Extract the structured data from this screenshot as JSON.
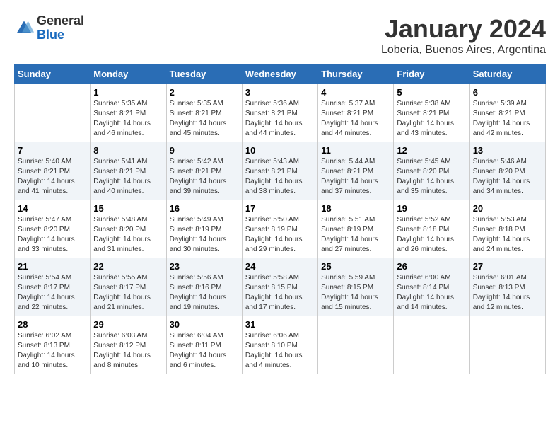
{
  "logo": {
    "general": "General",
    "blue": "Blue"
  },
  "header": {
    "title": "January 2024",
    "subtitle": "Loberia, Buenos Aires, Argentina"
  },
  "weekdays": [
    "Sunday",
    "Monday",
    "Tuesday",
    "Wednesday",
    "Thursday",
    "Friday",
    "Saturday"
  ],
  "weeks": [
    [
      {
        "day": "",
        "info": ""
      },
      {
        "day": "1",
        "info": "Sunrise: 5:35 AM\nSunset: 8:21 PM\nDaylight: 14 hours\nand 46 minutes."
      },
      {
        "day": "2",
        "info": "Sunrise: 5:35 AM\nSunset: 8:21 PM\nDaylight: 14 hours\nand 45 minutes."
      },
      {
        "day": "3",
        "info": "Sunrise: 5:36 AM\nSunset: 8:21 PM\nDaylight: 14 hours\nand 44 minutes."
      },
      {
        "day": "4",
        "info": "Sunrise: 5:37 AM\nSunset: 8:21 PM\nDaylight: 14 hours\nand 44 minutes."
      },
      {
        "day": "5",
        "info": "Sunrise: 5:38 AM\nSunset: 8:21 PM\nDaylight: 14 hours\nand 43 minutes."
      },
      {
        "day": "6",
        "info": "Sunrise: 5:39 AM\nSunset: 8:21 PM\nDaylight: 14 hours\nand 42 minutes."
      }
    ],
    [
      {
        "day": "7",
        "info": "Sunrise: 5:40 AM\nSunset: 8:21 PM\nDaylight: 14 hours\nand 41 minutes."
      },
      {
        "day": "8",
        "info": "Sunrise: 5:41 AM\nSunset: 8:21 PM\nDaylight: 14 hours\nand 40 minutes."
      },
      {
        "day": "9",
        "info": "Sunrise: 5:42 AM\nSunset: 8:21 PM\nDaylight: 14 hours\nand 39 minutes."
      },
      {
        "day": "10",
        "info": "Sunrise: 5:43 AM\nSunset: 8:21 PM\nDaylight: 14 hours\nand 38 minutes."
      },
      {
        "day": "11",
        "info": "Sunrise: 5:44 AM\nSunset: 8:21 PM\nDaylight: 14 hours\nand 37 minutes."
      },
      {
        "day": "12",
        "info": "Sunrise: 5:45 AM\nSunset: 8:20 PM\nDaylight: 14 hours\nand 35 minutes."
      },
      {
        "day": "13",
        "info": "Sunrise: 5:46 AM\nSunset: 8:20 PM\nDaylight: 14 hours\nand 34 minutes."
      }
    ],
    [
      {
        "day": "14",
        "info": "Sunrise: 5:47 AM\nSunset: 8:20 PM\nDaylight: 14 hours\nand 33 minutes."
      },
      {
        "day": "15",
        "info": "Sunrise: 5:48 AM\nSunset: 8:20 PM\nDaylight: 14 hours\nand 31 minutes."
      },
      {
        "day": "16",
        "info": "Sunrise: 5:49 AM\nSunset: 8:19 PM\nDaylight: 14 hours\nand 30 minutes."
      },
      {
        "day": "17",
        "info": "Sunrise: 5:50 AM\nSunset: 8:19 PM\nDaylight: 14 hours\nand 29 minutes."
      },
      {
        "day": "18",
        "info": "Sunrise: 5:51 AM\nSunset: 8:19 PM\nDaylight: 14 hours\nand 27 minutes."
      },
      {
        "day": "19",
        "info": "Sunrise: 5:52 AM\nSunset: 8:18 PM\nDaylight: 14 hours\nand 26 minutes."
      },
      {
        "day": "20",
        "info": "Sunrise: 5:53 AM\nSunset: 8:18 PM\nDaylight: 14 hours\nand 24 minutes."
      }
    ],
    [
      {
        "day": "21",
        "info": "Sunrise: 5:54 AM\nSunset: 8:17 PM\nDaylight: 14 hours\nand 22 minutes."
      },
      {
        "day": "22",
        "info": "Sunrise: 5:55 AM\nSunset: 8:17 PM\nDaylight: 14 hours\nand 21 minutes."
      },
      {
        "day": "23",
        "info": "Sunrise: 5:56 AM\nSunset: 8:16 PM\nDaylight: 14 hours\nand 19 minutes."
      },
      {
        "day": "24",
        "info": "Sunrise: 5:58 AM\nSunset: 8:15 PM\nDaylight: 14 hours\nand 17 minutes."
      },
      {
        "day": "25",
        "info": "Sunrise: 5:59 AM\nSunset: 8:15 PM\nDaylight: 14 hours\nand 15 minutes."
      },
      {
        "day": "26",
        "info": "Sunrise: 6:00 AM\nSunset: 8:14 PM\nDaylight: 14 hours\nand 14 minutes."
      },
      {
        "day": "27",
        "info": "Sunrise: 6:01 AM\nSunset: 8:13 PM\nDaylight: 14 hours\nand 12 minutes."
      }
    ],
    [
      {
        "day": "28",
        "info": "Sunrise: 6:02 AM\nSunset: 8:13 PM\nDaylight: 14 hours\nand 10 minutes."
      },
      {
        "day": "29",
        "info": "Sunrise: 6:03 AM\nSunset: 8:12 PM\nDaylight: 14 hours\nand 8 minutes."
      },
      {
        "day": "30",
        "info": "Sunrise: 6:04 AM\nSunset: 8:11 PM\nDaylight: 14 hours\nand 6 minutes."
      },
      {
        "day": "31",
        "info": "Sunrise: 6:06 AM\nSunset: 8:10 PM\nDaylight: 14 hours\nand 4 minutes."
      },
      {
        "day": "",
        "info": ""
      },
      {
        "day": "",
        "info": ""
      },
      {
        "day": "",
        "info": ""
      }
    ]
  ]
}
